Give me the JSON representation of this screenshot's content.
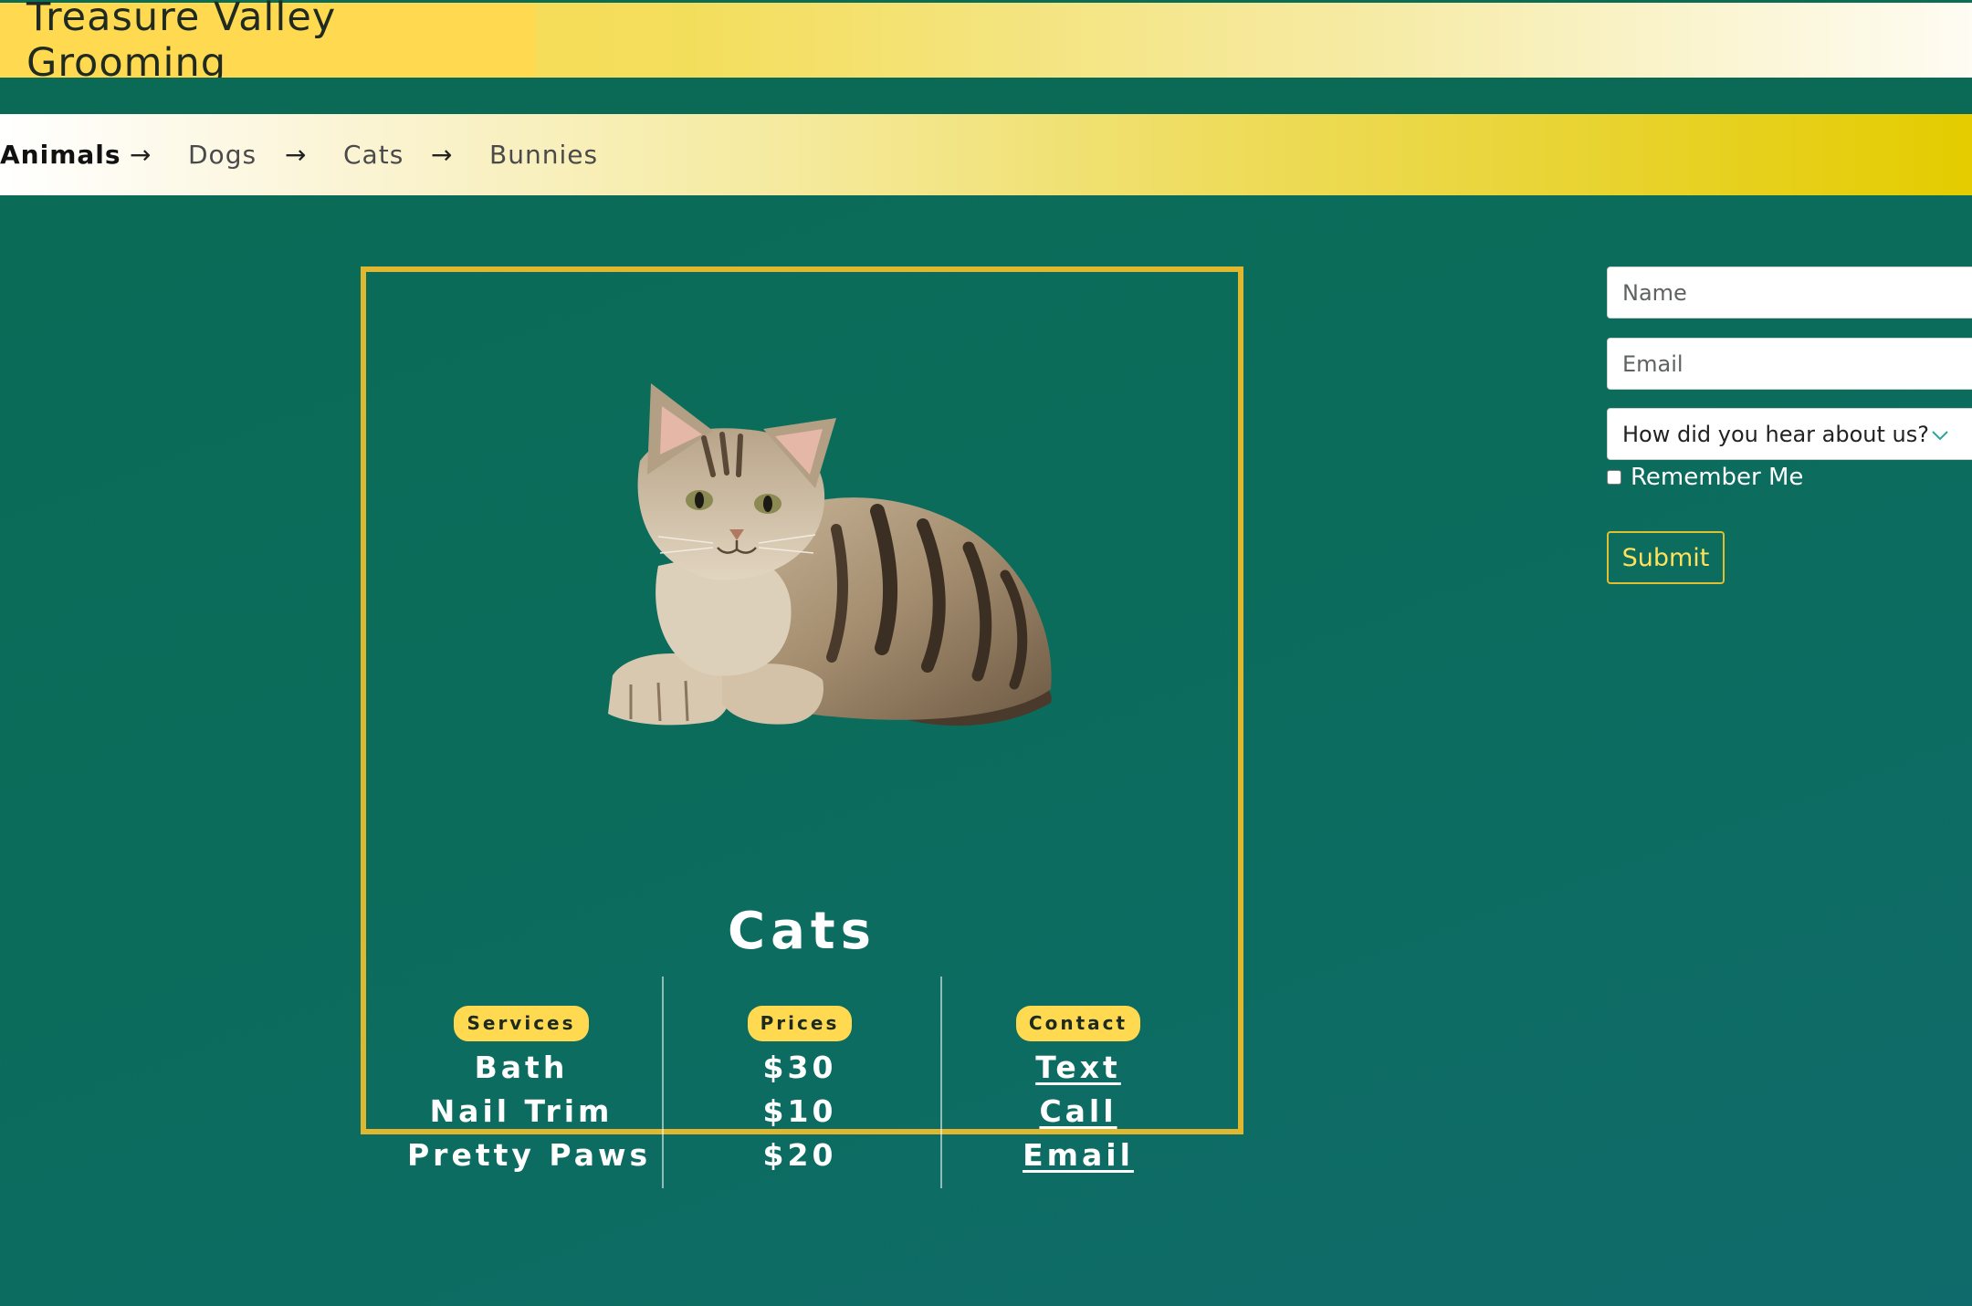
{
  "header": {
    "brand": "Treasure Valley Grooming"
  },
  "nav": {
    "items": [
      {
        "label": "Animals",
        "active": true
      },
      {
        "label": "Dogs",
        "active": false
      },
      {
        "label": "Cats",
        "active": false
      },
      {
        "label": "Bunnies",
        "active": false
      }
    ],
    "separator": "→"
  },
  "card": {
    "image": "cat-kitten-image",
    "title": "Cats",
    "services": {
      "badge": "Services",
      "items": [
        "Bath",
        "Nail Trim",
        "Pretty Paws"
      ]
    },
    "prices": {
      "badge": "Prices",
      "items": [
        "$30",
        "$10",
        "$20"
      ]
    },
    "contact": {
      "badge": "Contact",
      "items": [
        "Text",
        "Call",
        "Email"
      ]
    }
  },
  "form": {
    "name_placeholder": "Name",
    "email_placeholder": "Email",
    "referral_select": "How did you hear about us?",
    "remember_label": "Remember Me",
    "submit_label": "Submit"
  },
  "colors": {
    "background": "#0b6c5c",
    "accent_yellow": "#ffd94f",
    "card_border": "#e0b830",
    "submit_text": "#ffe25a"
  }
}
